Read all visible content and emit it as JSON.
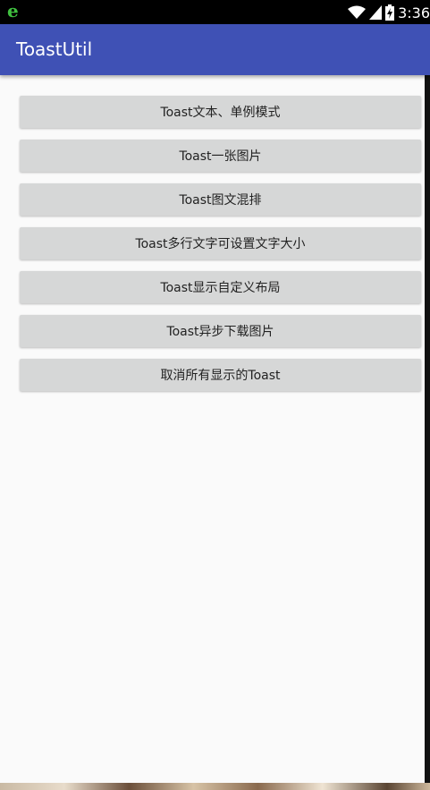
{
  "status_bar": {
    "time": "3:36",
    "left_icon": "browser-e-icon",
    "icons": [
      "wifi-icon",
      "signal-icon",
      "battery-icon"
    ]
  },
  "app_bar": {
    "title": "ToastUtil",
    "color": "#3f51b5"
  },
  "buttons": [
    {
      "label": "Toast文本、单例模式"
    },
    {
      "label": "Toast一张图片"
    },
    {
      "label": "Toast图文混排"
    },
    {
      "label": "Toast多行文字可设置文字大小"
    },
    {
      "label": "Toast显示自定义布局"
    },
    {
      "label": "Toast异步下载图片"
    },
    {
      "label": "取消所有显示的Toast"
    }
  ],
  "colors": {
    "background": "#fafafa",
    "button": "#d6d7d7",
    "button_text": "#222222"
  }
}
